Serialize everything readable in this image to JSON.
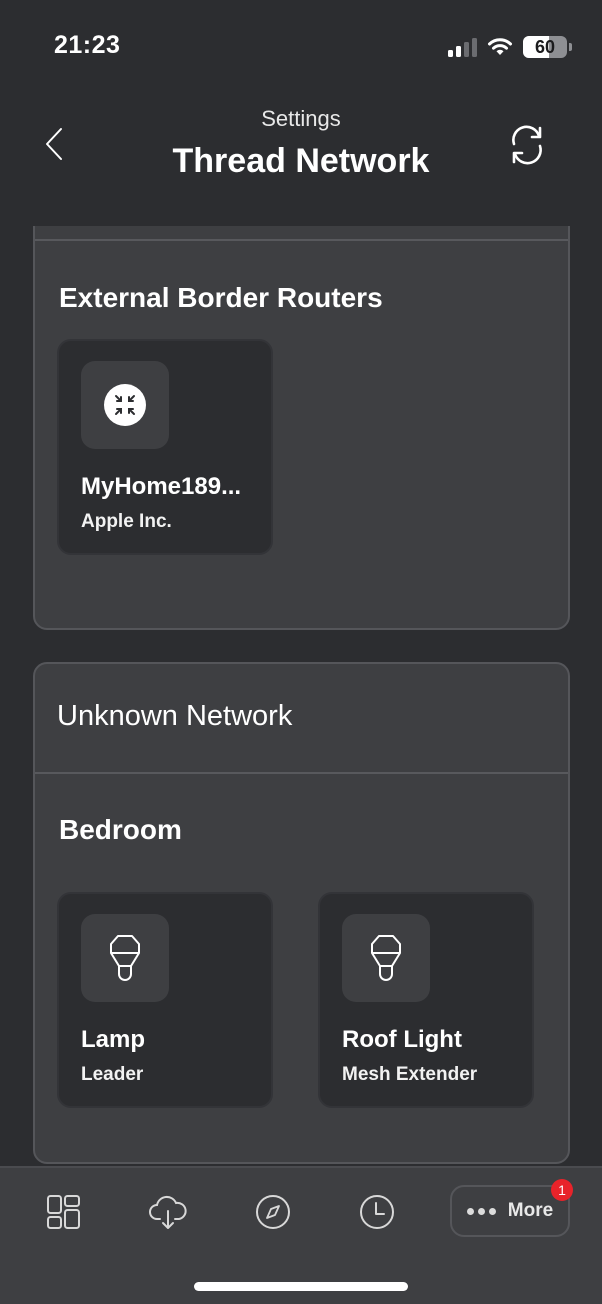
{
  "status_bar": {
    "time": "21:23",
    "battery_percent": 60,
    "battery_label": "60",
    "signal_bars_active": 2,
    "signal_bars_total": 4
  },
  "header": {
    "subtitle": "Settings",
    "title": "Thread Network",
    "back_icon": "chevron-left-icon",
    "refresh_icon": "refresh-icon"
  },
  "sections": [
    {
      "title": "External Border Routers",
      "devices": [
        {
          "name": "MyHome189...",
          "role": "Apple Inc.",
          "icon": "border-router-icon"
        }
      ]
    },
    {
      "network": "Unknown Network",
      "room": "Bedroom",
      "devices": [
        {
          "name": "Lamp",
          "role": "Leader",
          "icon": "bulb-icon"
        },
        {
          "name": "Roof Light",
          "role": "Mesh Extender",
          "icon": "bulb-icon"
        }
      ]
    }
  ],
  "tabbar": {
    "tabs": [
      {
        "icon": "dashboard-icon"
      },
      {
        "icon": "cloud-download-icon"
      },
      {
        "icon": "compass-icon"
      },
      {
        "icon": "clock-icon"
      }
    ],
    "more_label": "More",
    "more_badge": "1"
  },
  "colors": {
    "background": "#2c2d30",
    "card": "#3e3f42",
    "badge": "#e8232a"
  }
}
